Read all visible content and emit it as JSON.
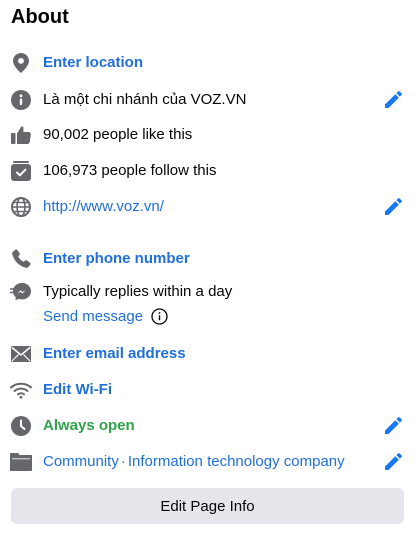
{
  "about": {
    "title": "About",
    "location": {
      "label": "Enter location",
      "icon": "location-pin-icon"
    },
    "description": {
      "label": "Là một chi nhánh của VOZ.VN",
      "icon": "info-icon"
    },
    "likes": {
      "label": "90,002 people like this",
      "icon": "thumbs-up-icon"
    },
    "follows": {
      "label": "106,973 people follow this",
      "icon": "follow-box-icon"
    },
    "website": {
      "label": "http://www.voz.vn/",
      "icon": "globe-icon"
    },
    "phone": {
      "label": "Enter phone number",
      "icon": "phone-icon"
    },
    "response": {
      "label": "Typically replies within a day",
      "icon": "messenger-icon"
    },
    "send_message": {
      "label": "Send message",
      "icon": "info-icon"
    },
    "email": {
      "label": "Enter email address",
      "icon": "envelope-icon"
    },
    "wifi": {
      "label": "Edit Wi-Fi",
      "icon": "wifi-icon"
    },
    "hours": {
      "label": "Always open",
      "icon": "clock-icon"
    },
    "category": {
      "item1": "Community",
      "separator": "·",
      "item2": "Information technology company",
      "icon": "category-card-icon"
    },
    "edit_button": "Edit Page Info"
  },
  "colors": {
    "link": "#216fdb",
    "green": "#31a24c",
    "icon": "#65676b",
    "pencil": "#1877f2",
    "button_bg": "#e4e6eb"
  }
}
